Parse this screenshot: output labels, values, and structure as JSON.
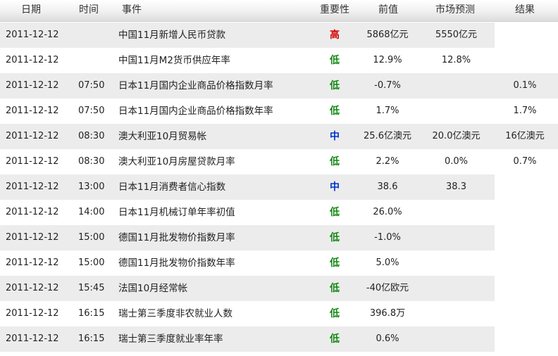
{
  "headers": {
    "date": "日期",
    "time": "时间",
    "event": "事件",
    "importance": "重要性",
    "previous": "前值",
    "forecast": "市场预测",
    "result": "结果"
  },
  "colors": {
    "high": "#d40000",
    "medium": "#0033cc",
    "low": "#118811"
  },
  "rows": [
    {
      "date": "2011-12-12",
      "time": "",
      "event": "中国11月新增人民币贷款",
      "importance": "高",
      "level": "high",
      "previous": "5868亿元",
      "forecast": "5550亿元",
      "result": ""
    },
    {
      "date": "2011-12-12",
      "time": "",
      "event": "中国11月M2货币供应年率",
      "importance": "低",
      "level": "low",
      "previous": "12.9%",
      "forecast": "12.8%",
      "result": ""
    },
    {
      "date": "2011-12-12",
      "time": "07:50",
      "event": "日本11月国内企业商品价格指数月率",
      "importance": "低",
      "level": "low",
      "previous": "-0.7%",
      "forecast": "",
      "result": "0.1%"
    },
    {
      "date": "2011-12-12",
      "time": "07:50",
      "event": "日本11月国内企业商品价格指数年率",
      "importance": "低",
      "level": "low",
      "previous": "1.7%",
      "forecast": "",
      "result": "1.7%"
    },
    {
      "date": "2011-12-12",
      "time": "08:30",
      "event": "澳大利亚10月贸易帐",
      "importance": "中",
      "level": "medium",
      "previous": "25.6亿澳元",
      "forecast": "20.0亿澳元",
      "result": "16亿澳元"
    },
    {
      "date": "2011-12-12",
      "time": "08:30",
      "event": "澳大利亚10月房屋贷款月率",
      "importance": "低",
      "level": "low",
      "previous": "2.2%",
      "forecast": "0.0%",
      "result": "0.7%"
    },
    {
      "date": "2011-12-12",
      "time": "13:00",
      "event": "日本11月消费者信心指数",
      "importance": "中",
      "level": "medium",
      "previous": "38.6",
      "forecast": "38.3",
      "result": ""
    },
    {
      "date": "2011-12-12",
      "time": "14:00",
      "event": "日本11月机械订单年率初值",
      "importance": "低",
      "level": "low",
      "previous": "26.0%",
      "forecast": "",
      "result": ""
    },
    {
      "date": "2011-12-12",
      "time": "15:00",
      "event": "德国11月批发物价指数月率",
      "importance": "低",
      "level": "low",
      "previous": "-1.0%",
      "forecast": "",
      "result": ""
    },
    {
      "date": "2011-12-12",
      "time": "15:00",
      "event": "德国11月批发物价指数年率",
      "importance": "低",
      "level": "low",
      "previous": "5.0%",
      "forecast": "",
      "result": ""
    },
    {
      "date": "2011-12-12",
      "time": "15:45",
      "event": "法国10月经常帐",
      "importance": "低",
      "level": "low",
      "previous": "-40亿欧元",
      "forecast": "",
      "result": ""
    },
    {
      "date": "2011-12-12",
      "time": "16:15",
      "event": "瑞士第三季度非农就业人数",
      "importance": "低",
      "level": "low",
      "previous": "396.8万",
      "forecast": "",
      "result": ""
    },
    {
      "date": "2011-12-12",
      "time": "16:15",
      "event": "瑞士第三季度就业率年率",
      "importance": "低",
      "level": "low",
      "previous": "0.6%",
      "forecast": "",
      "result": ""
    }
  ]
}
